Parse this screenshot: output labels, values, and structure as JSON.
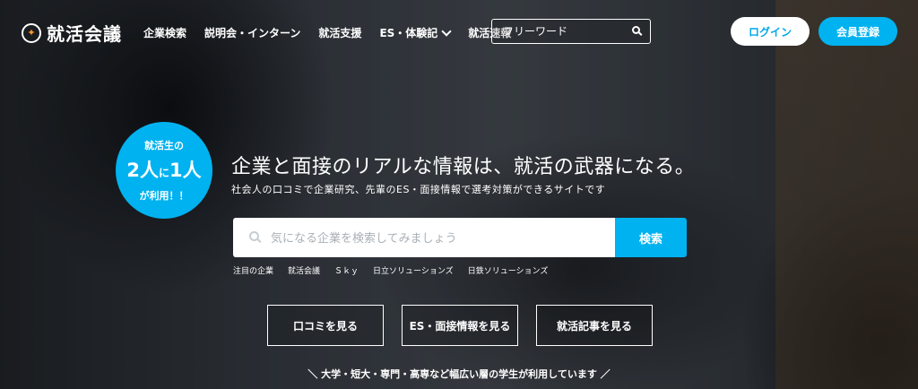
{
  "header": {
    "logo_text": "就活会議",
    "nav": [
      "企業検索",
      "説明会・インターン",
      "就活支援",
      "ES・体験記",
      "就活速報"
    ],
    "search_placeholder": "フリーワード",
    "login_label": "ログイン",
    "register_label": "会員登録"
  },
  "hero": {
    "badge": {
      "line1": "就活生の",
      "num1": "2人",
      "mid": "に",
      "num2": "1人",
      "line3": "が利用！！"
    },
    "headline": "企業と面接のリアルな情報は、就活の武器になる。",
    "subline": "社会人の口コミで企業研究、先輩のES・面接情報で選考対策ができるサイトです",
    "search_placeholder": "気になる企業を検索してみましょう",
    "search_button": "検索",
    "tags": [
      "注目の企業",
      "就活会議",
      "Ｓｋｙ",
      "日立ソリューションズ",
      "日鉄ソリューションズ"
    ],
    "actions": [
      "口コミを見る",
      "ES・面接情報を見る",
      "就活記事を見る"
    ],
    "footer_note": "＼ 大学・短大・専門・高専など幅広い層の学生が利用しています ／"
  },
  "colors": {
    "accent": "#00b2f0",
    "login_text": "#00a9e6"
  }
}
